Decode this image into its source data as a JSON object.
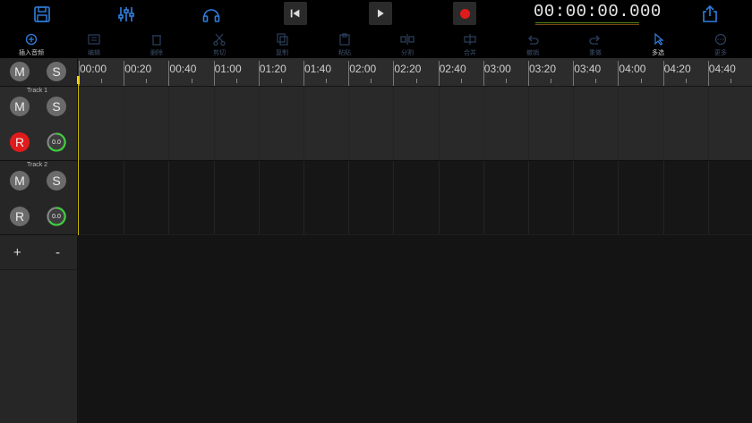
{
  "toolbar": {
    "icons": [
      "save-icon",
      "mixer-icon",
      "headphones-icon",
      "skip-back-icon",
      "play-icon",
      "record-icon",
      "share-icon"
    ],
    "timecode": "00:00:00.000",
    "accent": "#2f7fe0",
    "record_color": "#e01b1b"
  },
  "functions": [
    {
      "label": "插入音频",
      "icon": "insert-audio-icon",
      "active": true
    },
    {
      "label": "编辑",
      "icon": "edit-icon",
      "active": false
    },
    {
      "label": "删除",
      "icon": "delete-icon",
      "active": false
    },
    {
      "label": "剪切",
      "icon": "cut-icon",
      "active": false
    },
    {
      "label": "复制",
      "icon": "copy-icon",
      "active": false
    },
    {
      "label": "粘贴",
      "icon": "paste-icon",
      "active": false
    },
    {
      "label": "分割",
      "icon": "split-icon",
      "active": false
    },
    {
      "label": "合并",
      "icon": "merge-icon",
      "active": false
    },
    {
      "label": "撤销",
      "icon": "undo-icon",
      "active": false
    },
    {
      "label": "重做",
      "icon": "redo-icon",
      "active": false
    },
    {
      "label": "多选",
      "icon": "multi-select-icon",
      "active": true
    },
    {
      "label": "更多",
      "icon": "more-icon",
      "active": false
    }
  ],
  "ruler": {
    "ticks": [
      "00:00",
      "00:20",
      "00:40",
      "01:00",
      "01:20",
      "01:40",
      "02:00",
      "02:20",
      "02:40",
      "03:00",
      "03:20",
      "03:40",
      "04:00",
      "04:20",
      "04:40"
    ]
  },
  "master": {
    "mute": "M",
    "solo": "S"
  },
  "tracks": [
    {
      "name": "Track 1",
      "mute": "M",
      "solo": "S",
      "record": "R",
      "armed": true,
      "volume": "0.0"
    },
    {
      "name": "Track 2",
      "mute": "M",
      "solo": "S",
      "record": "R",
      "armed": false,
      "volume": "0.0"
    }
  ],
  "track_controls": {
    "add": "+",
    "remove": "-"
  }
}
